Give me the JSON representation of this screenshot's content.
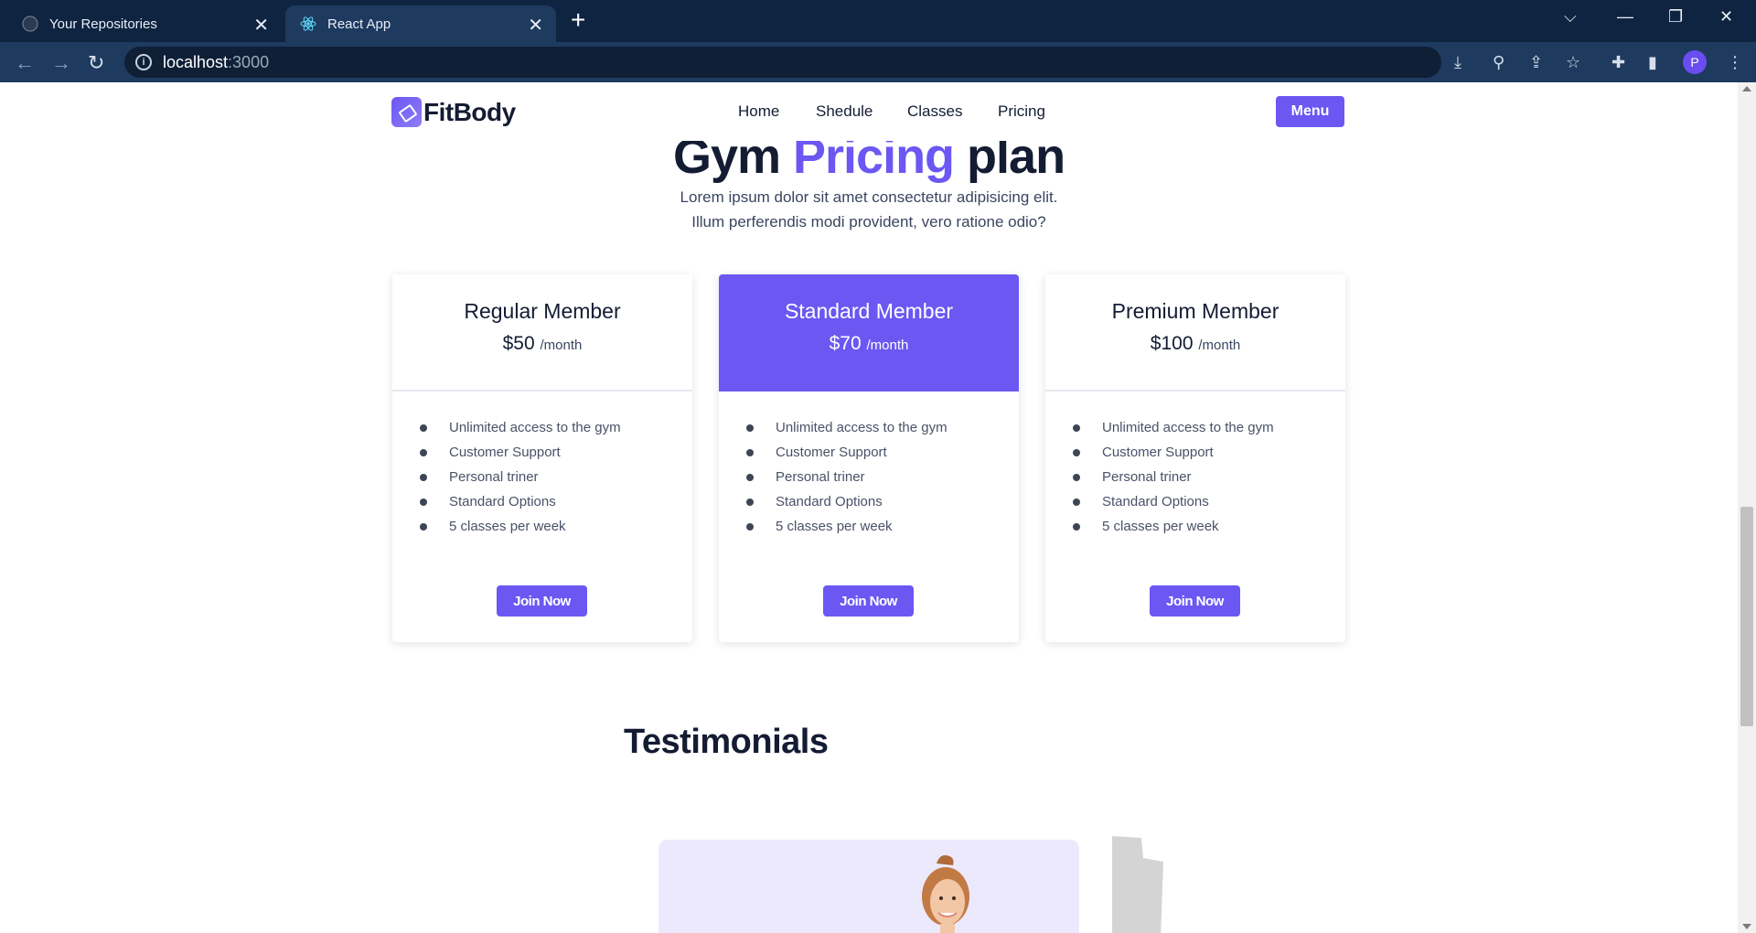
{
  "browser": {
    "tabs": [
      {
        "title": "Your Repositories",
        "active": false,
        "icon": "github-icon"
      },
      {
        "title": "React App",
        "active": true,
        "icon": "react-icon"
      }
    ],
    "url_host": "localhost",
    "url_port": ":3000",
    "profile_initial": "P"
  },
  "header": {
    "logo_text": "FitBody",
    "nav": [
      "Home",
      "Shedule",
      "Classes",
      "Pricing"
    ],
    "menu_label": "Menu"
  },
  "pricing": {
    "title_part1": "Gym ",
    "title_accent": "Pricing",
    "title_part2": " plan",
    "subtitle_line1": "Lorem ipsum dolor sit amet consectetur adipisicing elit.",
    "subtitle_line2": "Illum perferendis modi provident, vero ratione odio?",
    "plans": [
      {
        "name": "Regular Member",
        "price": "$50",
        "period": "/month",
        "featured": false,
        "features": [
          "Unlimited access to the gym",
          "Customer Support",
          "Personal triner",
          "Standard Options",
          "5 classes per week"
        ],
        "button": "Join Now"
      },
      {
        "name": "Standard Member",
        "price": "$70",
        "period": "/month",
        "featured": true,
        "features": [
          "Unlimited access to the gym",
          "Customer Support",
          "Personal triner",
          "Standard Options",
          "5 classes per week"
        ],
        "button": "Join Now"
      },
      {
        "name": "Premium Member",
        "price": "$100",
        "period": "/month",
        "featured": false,
        "features": [
          "Unlimited access to the gym",
          "Customer Support",
          "Personal triner",
          "Standard Options",
          "5 classes per week"
        ],
        "button": "Join Now"
      }
    ]
  },
  "testimonials": {
    "heading": "Testimonials"
  },
  "colors": {
    "accent": "#6c57f2",
    "dark_text": "#141c33",
    "testimonial_bg": "#ece9fd"
  }
}
